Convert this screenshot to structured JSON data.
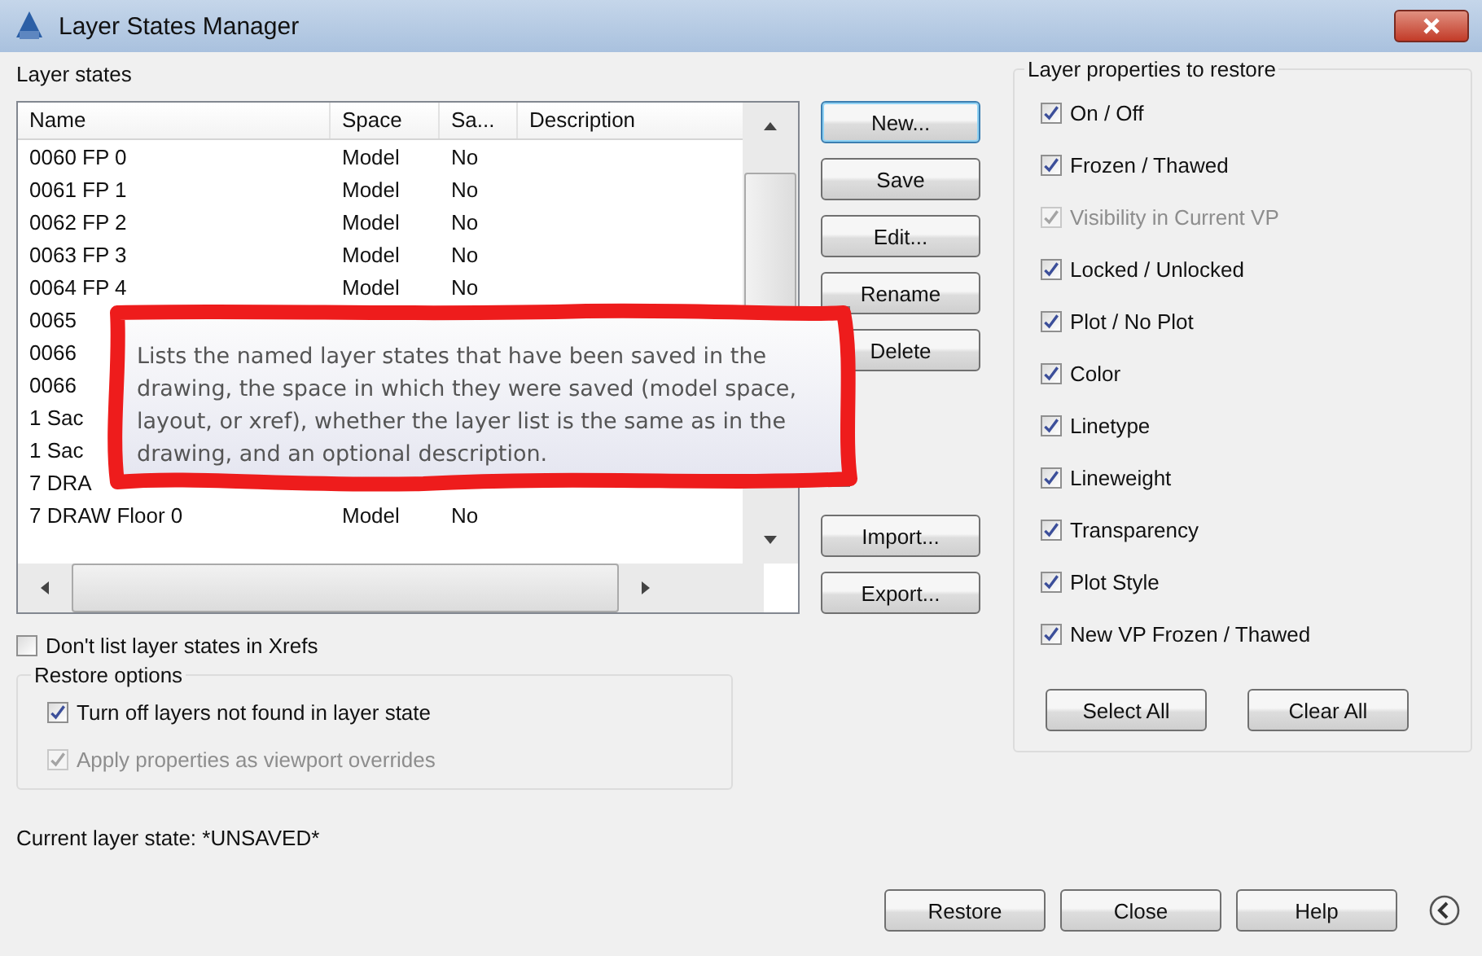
{
  "window": {
    "title": "Layer States Manager"
  },
  "layer_states": {
    "label": "Layer states",
    "columns": [
      "Name",
      "Space",
      "Sa...",
      "Description"
    ],
    "rows": [
      {
        "name": "0060 FP 0",
        "space": "Model",
        "saved": "No"
      },
      {
        "name": "0061 FP 1",
        "space": "Model",
        "saved": "No"
      },
      {
        "name": "0062 FP 2",
        "space": "Model",
        "saved": "No"
      },
      {
        "name": "0063 FP 3",
        "space": "Model",
        "saved": "No"
      },
      {
        "name": "0064 FP 4",
        "space": "Model",
        "saved": "No"
      },
      {
        "name": "0065"
      },
      {
        "name": "0066"
      },
      {
        "name": "0066"
      },
      {
        "name": "1 Sac"
      },
      {
        "name": "1 Sac"
      },
      {
        "name": "7 DRA"
      },
      {
        "name": "7 DRAW Floor 0",
        "space": "Model",
        "saved": "No"
      }
    ]
  },
  "tooltip": "Lists the named layer states that have been saved in the drawing, the space in which they were saved (model space, layout, or xref), whether the layer list is the same as in the drawing, and an optional description.",
  "side_buttons": [
    {
      "label": "New...",
      "kind": "top"
    },
    {
      "label": "Save",
      "kind": "top"
    },
    {
      "label": "Edit...",
      "kind": "top"
    },
    {
      "label": "Rename",
      "kind": "top"
    },
    {
      "label": "Delete",
      "kind": "top"
    },
    {
      "label": "Import...",
      "kind": "bottom"
    },
    {
      "label": "Export...",
      "kind": "bottom"
    }
  ],
  "dont_list_xrefs": {
    "label": "Don't list layer states in Xrefs",
    "checked": false
  },
  "restore_options": {
    "title": "Restore options",
    "options": [
      {
        "label": "Turn off layers not found in layer state",
        "checked": true,
        "disabled": false
      },
      {
        "label": "Apply properties as viewport overrides",
        "checked": true,
        "disabled": true
      }
    ]
  },
  "current_state": "Current layer state: *UNSAVED*",
  "properties": {
    "title": "Layer properties to restore",
    "items": [
      {
        "label": "On / Off",
        "checked": true,
        "disabled": false
      },
      {
        "label": "Frozen / Thawed",
        "checked": true,
        "disabled": false
      },
      {
        "label": "Visibility in Current VP",
        "checked": true,
        "disabled": true
      },
      {
        "label": "Locked / Unlocked",
        "checked": true,
        "disabled": false
      },
      {
        "label": "Plot / No Plot",
        "checked": true,
        "disabled": false
      },
      {
        "label": "Color",
        "checked": true,
        "disabled": false
      },
      {
        "label": "Linetype",
        "checked": true,
        "disabled": false
      },
      {
        "label": "Lineweight",
        "checked": true,
        "disabled": false
      },
      {
        "label": "Transparency",
        "checked": true,
        "disabled": false
      },
      {
        "label": "Plot Style",
        "checked": true,
        "disabled": false
      },
      {
        "label": "New VP Frozen / Thawed",
        "checked": true,
        "disabled": false
      }
    ],
    "buttons": [
      "Select All",
      "Clear All"
    ]
  },
  "footer_buttons": [
    "Restore",
    "Close",
    "Help"
  ]
}
